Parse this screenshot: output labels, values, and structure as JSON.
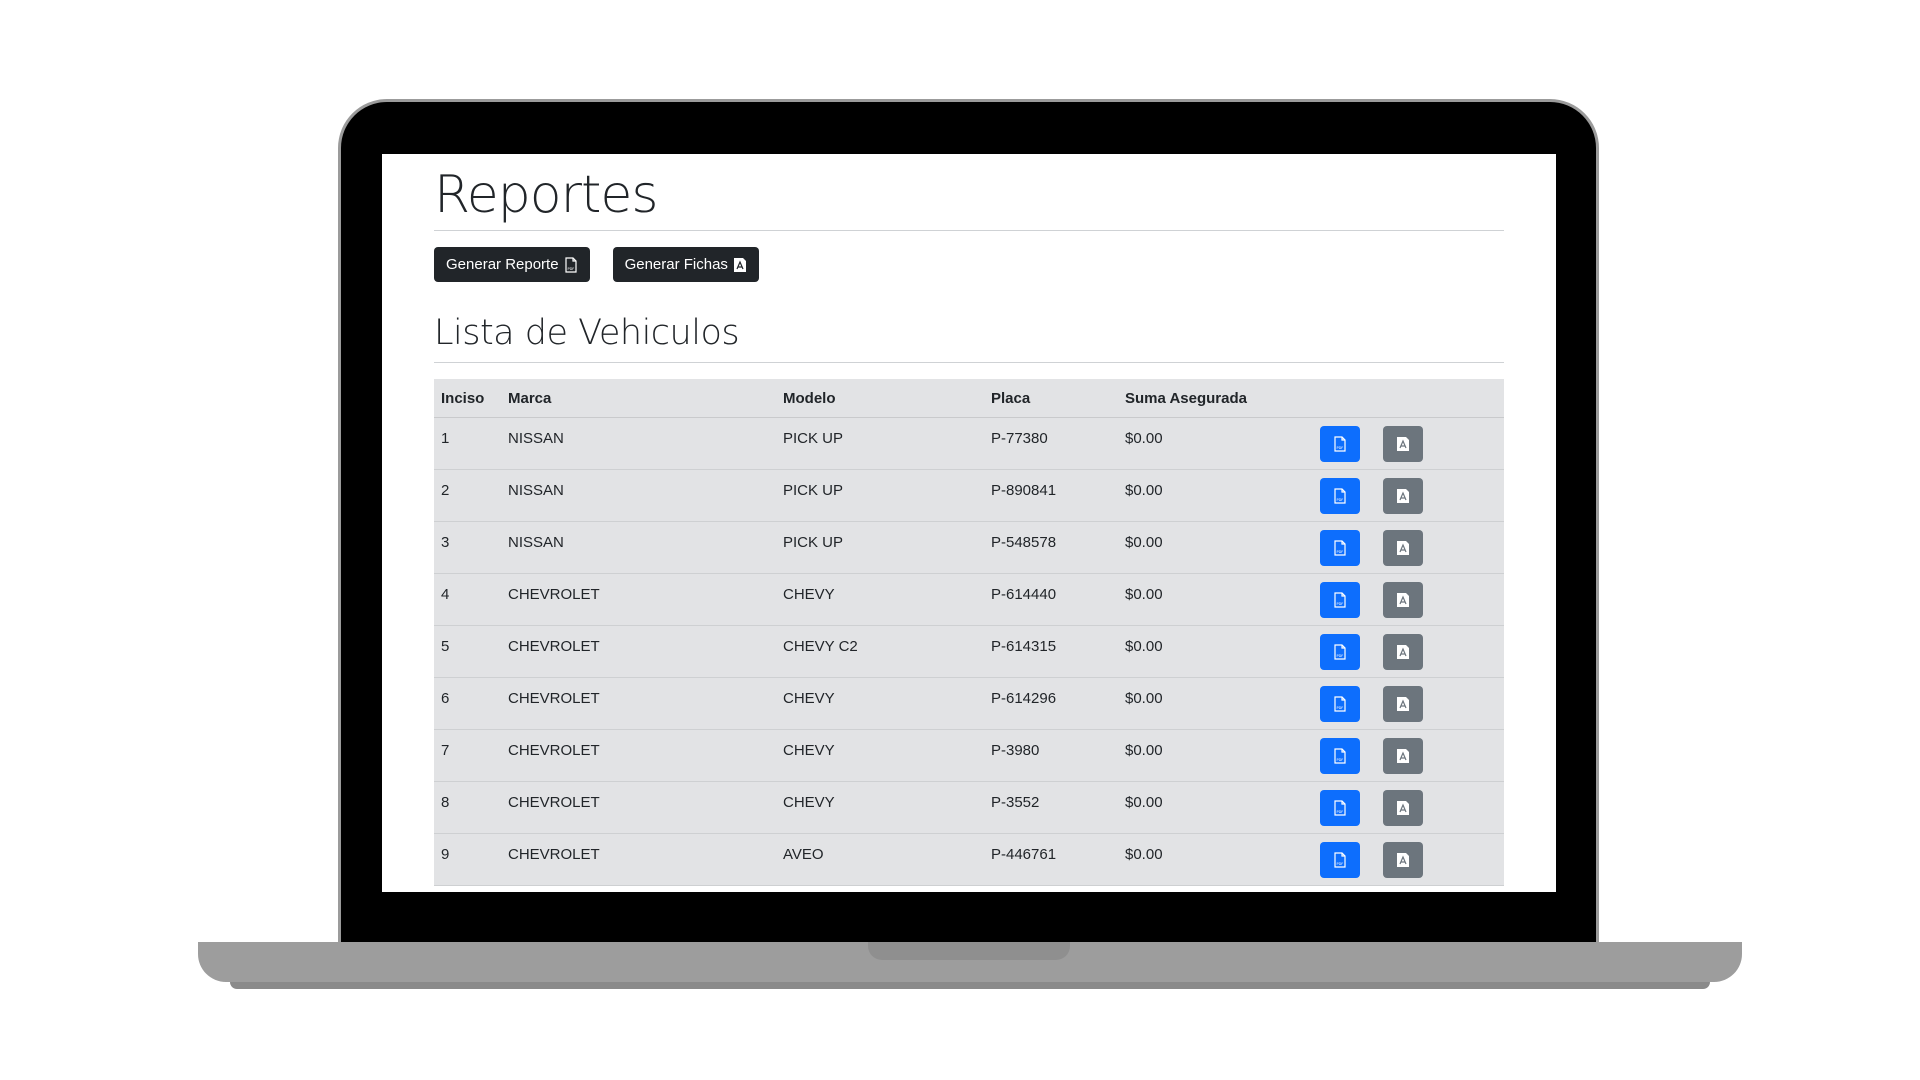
{
  "page": {
    "title": "Reportes",
    "buttons": {
      "generar_reporte": "Generar Reporte",
      "generar_fichas": "Generar Fichas"
    },
    "section_title": "Lista de Vehiculos"
  },
  "table": {
    "headers": [
      "Inciso",
      "Marca",
      "Modelo",
      "Placa",
      "Suma Asegurada"
    ],
    "rows": [
      {
        "inciso": "1",
        "marca": "NISSAN",
        "modelo": "PICK UP",
        "placa": "P-77380",
        "suma": "$0.00"
      },
      {
        "inciso": "2",
        "marca": "NISSAN",
        "modelo": "PICK UP",
        "placa": "P-890841",
        "suma": "$0.00"
      },
      {
        "inciso": "3",
        "marca": "NISSAN",
        "modelo": "PICK UP",
        "placa": "P-548578",
        "suma": "$0.00"
      },
      {
        "inciso": "4",
        "marca": "CHEVROLET",
        "modelo": "CHEVY",
        "placa": "P-614440",
        "suma": "$0.00"
      },
      {
        "inciso": "5",
        "marca": "CHEVROLET",
        "modelo": "CHEVY C2",
        "placa": "P-614315",
        "suma": "$0.00"
      },
      {
        "inciso": "6",
        "marca": "CHEVROLET",
        "modelo": "CHEVY",
        "placa": "P-614296",
        "suma": "$0.00"
      },
      {
        "inciso": "7",
        "marca": "CHEVROLET",
        "modelo": "CHEVY",
        "placa": "P-3980",
        "suma": "$0.00"
      },
      {
        "inciso": "8",
        "marca": "CHEVROLET",
        "modelo": "CHEVY",
        "placa": "P-3552",
        "suma": "$0.00"
      },
      {
        "inciso": "9",
        "marca": "CHEVROLET",
        "modelo": "AVEO",
        "placa": "P-446761",
        "suma": "$0.00"
      }
    ]
  },
  "icons": {
    "reporte_button_icon": "file-pdf-icon",
    "ficha_button_icon": "acrobat-file-icon"
  },
  "colors": {
    "primary": "#0d6efd",
    "secondary": "#6c757d",
    "dark": "#212529",
    "table_bg": "#e2e3e5"
  }
}
